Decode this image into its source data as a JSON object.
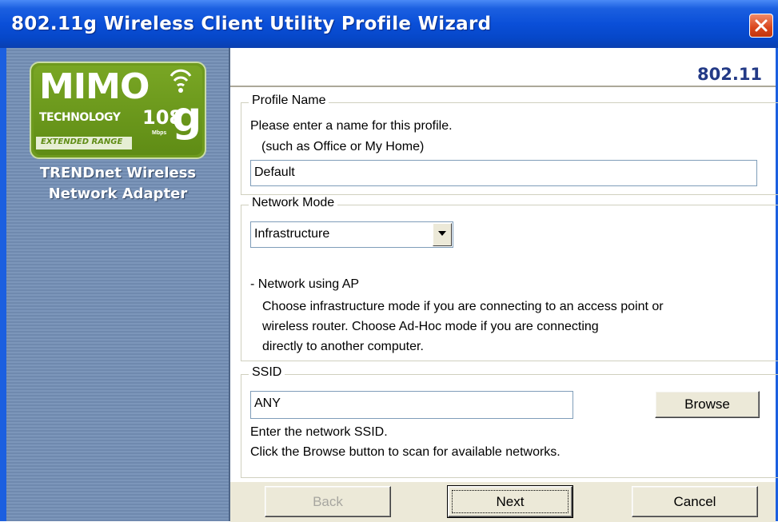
{
  "window": {
    "title": "802.11g Wireless Client Utility Profile Wizard",
    "close_icon": "close-icon"
  },
  "sidebar": {
    "logo": {
      "mimo": "MIMO",
      "technology": "TECHNOLOGY",
      "speed": "108",
      "unit": "Mbps",
      "g": "g",
      "extended": "EXTENDED RANGE"
    },
    "brand_line1": "TRENDnet Wireless",
    "brand_line2": "Network Adapter"
  },
  "header": {
    "corner_label": "802.11"
  },
  "profile_name": {
    "legend": "Profile Name",
    "instruction": "Please enter a name for this profile.",
    "example": "(such as Office or My Home)",
    "value": "Default"
  },
  "network_mode": {
    "legend": "Network Mode",
    "selected": "Infrastructure",
    "desc_title": "- Network using AP",
    "desc_line1": "Choose infrastructure mode if you are connecting to an access point or",
    "desc_line2": "wireless router. Choose Ad-Hoc mode if you are connecting",
    "desc_line3": "directly to another computer."
  },
  "ssid": {
    "legend": "SSID",
    "value": "ANY",
    "browse_label": "Browse",
    "help1": "Enter the network SSID.",
    "help2": "Click the Browse button to scan for available networks."
  },
  "footer": {
    "back_label": "Back",
    "next_label": "Next",
    "cancel_label": "Cancel"
  },
  "colors": {
    "titlebar": "#0a4fd8",
    "sidebar": "#7c96ba",
    "logo_green": "#6e9a1e",
    "corner_label": "#233a86",
    "button_face": "#ece9d8"
  }
}
